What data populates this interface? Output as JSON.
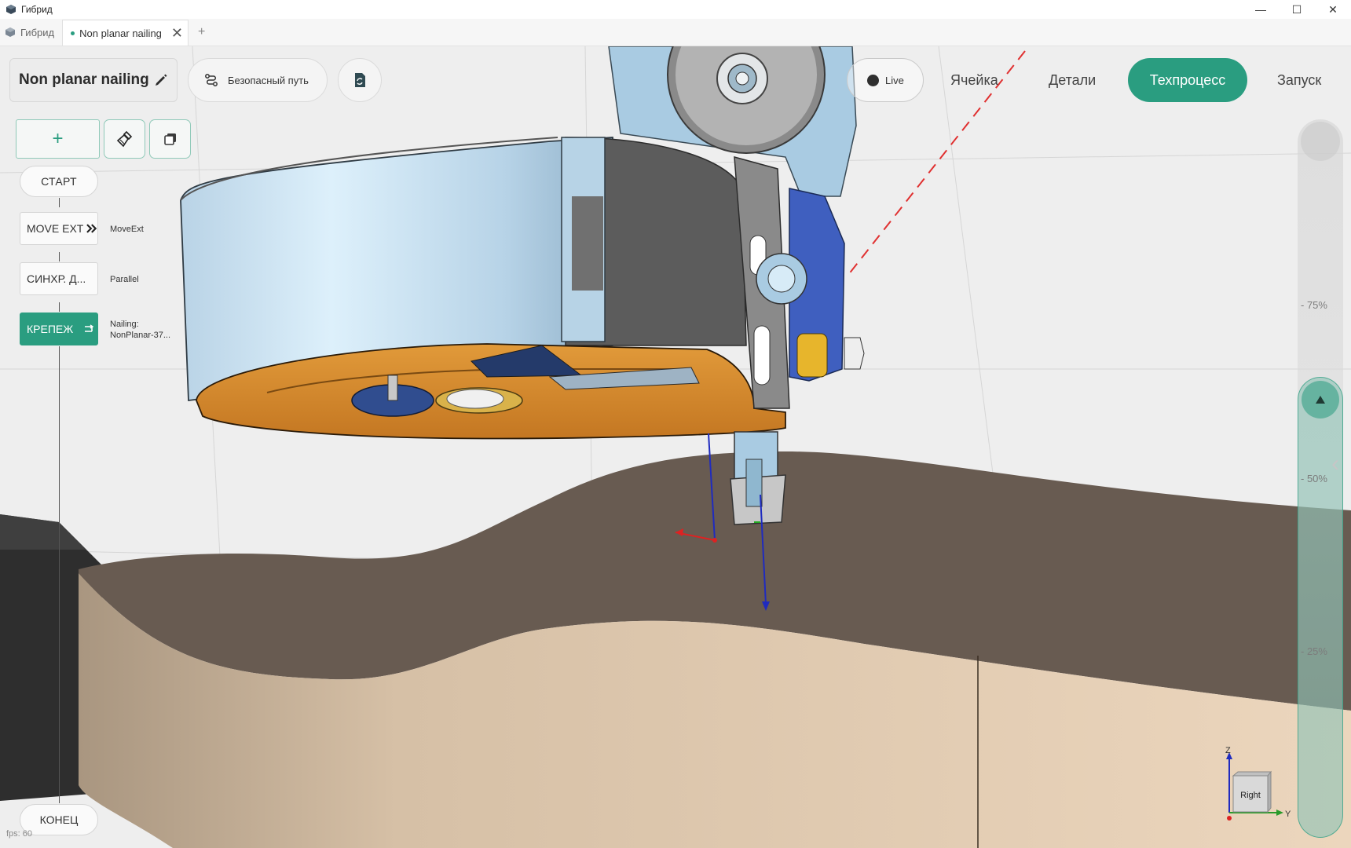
{
  "window": {
    "title": "Гибрид",
    "controls": {
      "minimize": "—",
      "maximize": "☐",
      "close": "✕"
    }
  },
  "tabs": {
    "home_label": "Гибрид",
    "active_tab": "Non planar nailing",
    "close_glyph": "✕",
    "add_glyph": "+"
  },
  "toolbar": {
    "project_title": "Non planar nailing",
    "safe_path_label": "Безопасный путь"
  },
  "nav": {
    "live_label": "Live",
    "cell_label": "Ячейка",
    "details_label": "Детали",
    "process_label": "Техпроцесс",
    "run_label": "Запуск"
  },
  "program_tree": {
    "add_glyph": "+",
    "start_label": "СТАРТ",
    "end_label": "КОНЕЦ",
    "nodes": [
      {
        "label": "MOVE EXT",
        "desc": "MoveExt",
        "active": false
      },
      {
        "label": "СИНХР. Д...",
        "desc": "Parallel",
        "active": false
      },
      {
        "label": "КРЕПЕЖ",
        "desc": "Nailing:",
        "desc2": "NonPlanar-37...",
        "active": true
      }
    ]
  },
  "timeline": {
    "marks": [
      "75%",
      "50%",
      "25%"
    ],
    "level_percent": 50
  },
  "gizmo": {
    "cube_label": "Right",
    "axis_z": "Z",
    "axis_y": "Y"
  },
  "status": {
    "fps": "fps: 60"
  },
  "colors": {
    "accent": "#2a9d80",
    "tool_orange": "#d98a2a",
    "tool_blue": "#c8e4f4",
    "wood_light": "#e8d2ba",
    "wood_top": "#6b5f54"
  }
}
